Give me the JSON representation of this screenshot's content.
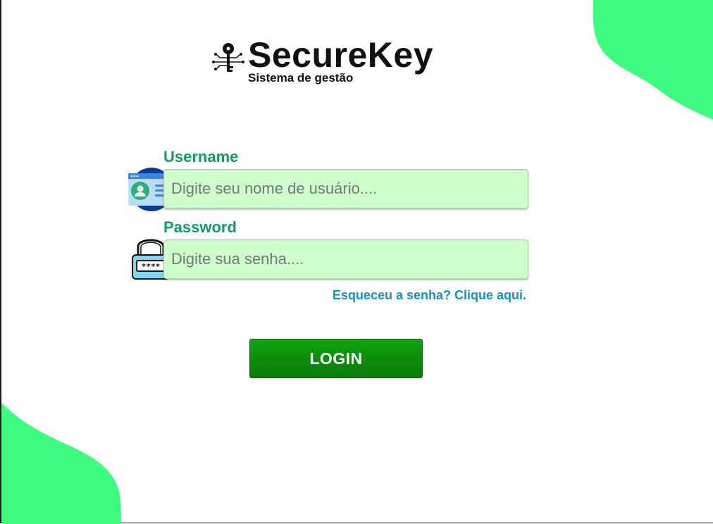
{
  "brand": {
    "name": "SecureKey",
    "subtitle": "Sistema de gestão",
    "icon": "circuit-key-icon"
  },
  "form": {
    "username": {
      "label": "Username",
      "placeholder": "Digite seu nome de usuário....",
      "value": "",
      "icon": "id-card-user-icon"
    },
    "password": {
      "label": "Password",
      "placeholder": "Digite sua senha....",
      "value": "",
      "icon": "padlock-password-icon"
    },
    "forgot_link": "Esqueceu a senha? Clique aqui.",
    "login_button": "LOGIN"
  },
  "colors": {
    "accent_green": "#3dfc80",
    "label_green": "#119a6d",
    "input_bg": "#ccffcc",
    "link_blue": "#1194c4",
    "button_green": "#0c8c0c"
  }
}
